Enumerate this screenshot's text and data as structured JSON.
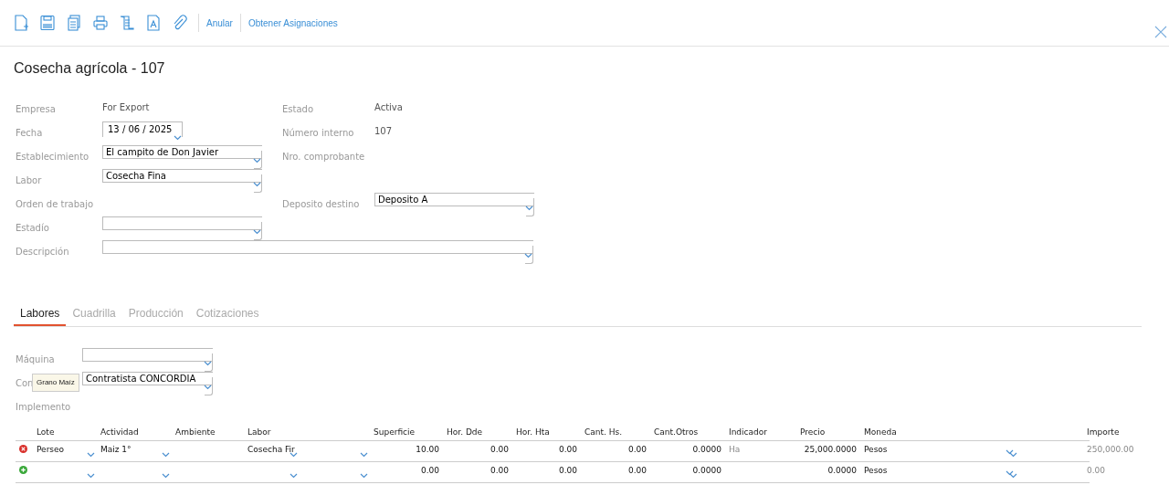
{
  "toolbar": {
    "links": [
      "Anular",
      "Obtener Asignaciones"
    ]
  },
  "title": "Cosecha agrícola - 107",
  "form": {
    "rows": [
      {
        "label": "Empresa",
        "value": "For Export",
        "kind": "text",
        "right": {
          "label": "Estado",
          "value": "Activa",
          "kind": "text"
        }
      },
      {
        "label": "Fecha",
        "value": "13 / 06 /  2025",
        "kind": "date",
        "right": {
          "label": "Número interno",
          "value": "107",
          "kind": "text"
        }
      },
      {
        "label": "Establecimiento",
        "value": "El campito de Don Javier",
        "kind": "select",
        "right": {
          "label": "Nro. comprobante"
        }
      },
      {
        "label": "Labor",
        "value": "Cosecha Fina",
        "kind": "select"
      },
      {
        "label": "Orden de trabajo",
        "right": {
          "label": "Deposito destino",
          "value": "Deposito A",
          "kind": "select"
        }
      },
      {
        "label": "Estadío",
        "kind": "select"
      },
      {
        "label": "Descripción",
        "kind": "wide"
      }
    ]
  },
  "tabs": [
    {
      "label": "Labores",
      "selected": true
    },
    {
      "label": "Cuadrilla",
      "selected": false
    },
    {
      "label": "Producción",
      "selected": false
    },
    {
      "label": "Cotizaciones",
      "selected": false
    }
  ],
  "labores": {
    "fields": [
      {
        "label": "Máquina"
      },
      {
        "label": "Con",
        "value": "Contratista CONCORDIA"
      }
    ],
    "tooltip": "Grano Maíz",
    "implemento_label": "Implemento"
  },
  "table": {
    "columns": [
      "Lote",
      "Actividad",
      "Ambiente",
      "Labor",
      "Superficie",
      "Hor. Dde",
      "Hor. Hta",
      "Cant. Hs.",
      "Cant.Otros",
      "Indicador",
      "Precio",
      "Moneda",
      "Importe"
    ],
    "rows": [
      {
        "kind": "remove",
        "lote": "Perseo",
        "actividad": "Maiz 1°",
        "labor": "Cosecha Fir",
        "superficie": "10.00",
        "hor_dde": "0.00",
        "hor_hta": "0.00",
        "cant_hs": "0.00",
        "cant_otros": "0.0000",
        "indicador": "Ha",
        "precio": "25,000.0000",
        "moneda": "Pesos",
        "importe": "250,000.00"
      },
      {
        "kind": "add",
        "superficie": "0.00",
        "hor_dde": "0.00",
        "hor_hta": "0.00",
        "cant_hs": "0.00",
        "cant_otros": "0.0000",
        "precio": "0.0000",
        "moneda": "Pesos",
        "importe": "0.00"
      }
    ]
  }
}
